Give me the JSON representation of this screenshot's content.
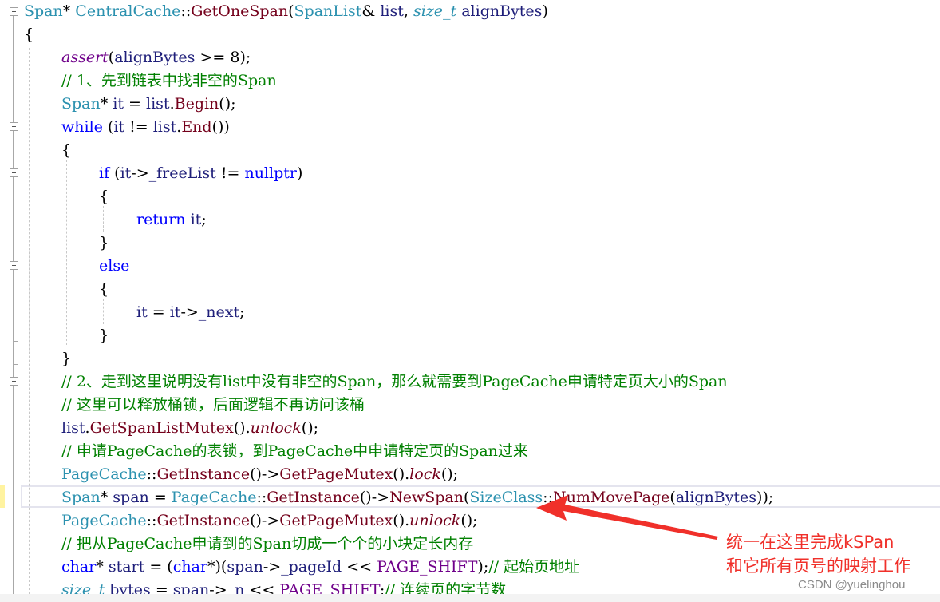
{
  "editor": {
    "colors": {
      "type": "#2b91af",
      "keyword": "#0000ff",
      "function": "#74001b",
      "macro": "#6f008a",
      "comment": "#008000",
      "identifier": "#1f1f7a",
      "annotation": "#f0302a"
    },
    "lines": [
      {
        "indent": 0,
        "tokens": [
          {
            "t": "Span",
            "c": "type"
          },
          {
            "t": "* ",
            "c": "plain"
          },
          {
            "t": "CentralCache",
            "c": "type"
          },
          {
            "t": "::",
            "c": "plain"
          },
          {
            "t": "GetOneSpan",
            "c": "function"
          },
          {
            "t": "(",
            "c": "plain"
          },
          {
            "t": "SpanList",
            "c": "type"
          },
          {
            "t": "& ",
            "c": "plain"
          },
          {
            "t": "list",
            "c": "param"
          },
          {
            "t": ", ",
            "c": "plain"
          },
          {
            "t": "size_t",
            "c": "typedef"
          },
          {
            "t": " ",
            "c": "plain"
          },
          {
            "t": "alignBytes",
            "c": "param"
          },
          {
            "t": ")",
            "c": "plain"
          }
        ]
      },
      {
        "indent": 0,
        "tokens": [
          {
            "t": "{",
            "c": "plain"
          }
        ]
      },
      {
        "indent": 1,
        "tokens": [
          {
            "t": "assert",
            "c": "macro"
          },
          {
            "t": "(",
            "c": "plain"
          },
          {
            "t": "alignBytes",
            "c": "param"
          },
          {
            "t": " >= 8);",
            "c": "plain"
          }
        ]
      },
      {
        "indent": 1,
        "tokens": [
          {
            "t": "// 1、先到链表中找非空的Span",
            "c": "comment"
          }
        ]
      },
      {
        "indent": 1,
        "tokens": [
          {
            "t": "Span",
            "c": "type"
          },
          {
            "t": "* ",
            "c": "plain"
          },
          {
            "t": "it",
            "c": "var"
          },
          {
            "t": " = ",
            "c": "plain"
          },
          {
            "t": "list",
            "c": "param"
          },
          {
            "t": ".",
            "c": "plain"
          },
          {
            "t": "Begin",
            "c": "function"
          },
          {
            "t": "();",
            "c": "plain"
          }
        ]
      },
      {
        "indent": 1,
        "tokens": [
          {
            "t": "while",
            "c": "keyword"
          },
          {
            "t": " (",
            "c": "plain"
          },
          {
            "t": "it",
            "c": "var"
          },
          {
            "t": " != ",
            "c": "plain"
          },
          {
            "t": "list",
            "c": "param"
          },
          {
            "t": ".",
            "c": "plain"
          },
          {
            "t": "End",
            "c": "function"
          },
          {
            "t": "())",
            "c": "plain"
          }
        ]
      },
      {
        "indent": 1,
        "tokens": [
          {
            "t": "{",
            "c": "plain"
          }
        ]
      },
      {
        "indent": 2,
        "tokens": [
          {
            "t": "if",
            "c": "keyword"
          },
          {
            "t": " (",
            "c": "plain"
          },
          {
            "t": "it",
            "c": "var"
          },
          {
            "t": "->",
            "c": "plain"
          },
          {
            "t": "_freeList",
            "c": "member"
          },
          {
            "t": " != ",
            "c": "plain"
          },
          {
            "t": "nullptr",
            "c": "keyword"
          },
          {
            "t": ")",
            "c": "plain"
          }
        ]
      },
      {
        "indent": 2,
        "tokens": [
          {
            "t": "{",
            "c": "plain"
          }
        ]
      },
      {
        "indent": 3,
        "tokens": [
          {
            "t": "return",
            "c": "keyword"
          },
          {
            "t": " ",
            "c": "plain"
          },
          {
            "t": "it",
            "c": "var"
          },
          {
            "t": ";",
            "c": "plain"
          }
        ]
      },
      {
        "indent": 2,
        "tokens": [
          {
            "t": "}",
            "c": "plain"
          }
        ]
      },
      {
        "indent": 2,
        "tokens": [
          {
            "t": "else",
            "c": "keyword"
          }
        ]
      },
      {
        "indent": 2,
        "tokens": [
          {
            "t": "{",
            "c": "plain"
          }
        ]
      },
      {
        "indent": 3,
        "tokens": [
          {
            "t": "it",
            "c": "var"
          },
          {
            "t": " = ",
            "c": "plain"
          },
          {
            "t": "it",
            "c": "var"
          },
          {
            "t": "->",
            "c": "plain"
          },
          {
            "t": "_next",
            "c": "member"
          },
          {
            "t": ";",
            "c": "plain"
          }
        ]
      },
      {
        "indent": 2,
        "tokens": [
          {
            "t": "}",
            "c": "plain"
          }
        ]
      },
      {
        "indent": 1,
        "tokens": [
          {
            "t": "}",
            "c": "plain"
          }
        ]
      },
      {
        "indent": 1,
        "tokens": [
          {
            "t": "// 2、走到这里说明没有list中没有非空的Span，那么就需要到PageCache申请特定页大小的Span",
            "c": "comment"
          }
        ]
      },
      {
        "indent": 1,
        "tokens": [
          {
            "t": "// 这里可以释放桶锁，后面逻辑不再访问该桶",
            "c": "comment"
          }
        ]
      },
      {
        "indent": 1,
        "tokens": [
          {
            "t": "list",
            "c": "param"
          },
          {
            "t": ".",
            "c": "plain"
          },
          {
            "t": "GetSpanListMutex",
            "c": "function"
          },
          {
            "t": "().",
            "c": "plain"
          },
          {
            "t": "unlock",
            "c": "fn-it"
          },
          {
            "t": "();",
            "c": "plain"
          }
        ]
      },
      {
        "indent": 1,
        "tokens": [
          {
            "t": "// 申请PageCache的表锁，到PageCache中申请特定页的Span过来",
            "c": "comment"
          }
        ]
      },
      {
        "indent": 1,
        "tokens": [
          {
            "t": "PageCache",
            "c": "type"
          },
          {
            "t": "::",
            "c": "plain"
          },
          {
            "t": "GetInstance",
            "c": "function"
          },
          {
            "t": "()->",
            "c": "plain"
          },
          {
            "t": "GetPageMutex",
            "c": "function"
          },
          {
            "t": "().",
            "c": "plain"
          },
          {
            "t": "lock",
            "c": "fn-it"
          },
          {
            "t": "();",
            "c": "plain"
          }
        ]
      },
      {
        "indent": 1,
        "tokens": [
          {
            "t": "Span",
            "c": "type"
          },
          {
            "t": "* ",
            "c": "plain"
          },
          {
            "t": "span",
            "c": "var"
          },
          {
            "t": " = ",
            "c": "plain"
          },
          {
            "t": "PageCache",
            "c": "type"
          },
          {
            "t": "::",
            "c": "plain"
          },
          {
            "t": "GetInstance",
            "c": "function"
          },
          {
            "t": "()->",
            "c": "plain"
          },
          {
            "t": "NewSpan",
            "c": "function"
          },
          {
            "t": "(",
            "c": "plain"
          },
          {
            "t": "SizeClass",
            "c": "type"
          },
          {
            "t": "::",
            "c": "plain"
          },
          {
            "t": "NumMovePage",
            "c": "function"
          },
          {
            "t": "(",
            "c": "plain"
          },
          {
            "t": "alignBytes",
            "c": "param"
          },
          {
            "t": "));",
            "c": "plain"
          }
        ]
      },
      {
        "indent": 1,
        "tokens": [
          {
            "t": "PageCache",
            "c": "type"
          },
          {
            "t": "::",
            "c": "plain"
          },
          {
            "t": "GetInstance",
            "c": "function"
          },
          {
            "t": "()->",
            "c": "plain"
          },
          {
            "t": "GetPageMutex",
            "c": "function"
          },
          {
            "t": "().",
            "c": "plain"
          },
          {
            "t": "unlock",
            "c": "fn-it"
          },
          {
            "t": "();",
            "c": "plain"
          }
        ]
      },
      {
        "indent": 1,
        "tokens": [
          {
            "t": "// 把从PageCache申请到的Span切成一个个的小块定长内存",
            "c": "comment"
          }
        ]
      },
      {
        "indent": 1,
        "tokens": [
          {
            "t": "char",
            "c": "keyword"
          },
          {
            "t": "* ",
            "c": "plain"
          },
          {
            "t": "start",
            "c": "var"
          },
          {
            "t": " = (",
            "c": "plain"
          },
          {
            "t": "char",
            "c": "keyword"
          },
          {
            "t": "*)(",
            "c": "plain"
          },
          {
            "t": "span",
            "c": "var"
          },
          {
            "t": "->",
            "c": "plain"
          },
          {
            "t": "_pageId",
            "c": "member"
          },
          {
            "t": " << ",
            "c": "plain"
          },
          {
            "t": "PAGE_SHIFT",
            "c": "const"
          },
          {
            "t": ");",
            "c": "plain"
          },
          {
            "t": "// 起始页地址",
            "c": "comment"
          }
        ]
      },
      {
        "indent": 1,
        "tokens": [
          {
            "t": "size_t",
            "c": "typedef"
          },
          {
            "t": " ",
            "c": "plain"
          },
          {
            "t": "bytes",
            "c": "var"
          },
          {
            "t": " = ",
            "c": "plain"
          },
          {
            "t": "span",
            "c": "var"
          },
          {
            "t": "->",
            "c": "plain"
          },
          {
            "t": "_n",
            "c": "member"
          },
          {
            "t": " << ",
            "c": "plain"
          },
          {
            "t": "PAGE_SHIFT",
            "c": "const"
          },
          {
            "t": ";",
            "c": "plain"
          },
          {
            "t": "// 连续页的字节数",
            "c": "comment"
          }
        ]
      }
    ]
  },
  "annotation": {
    "line1": "统一在这里完成kSPan",
    "line2": "和它所有页号的映射工作"
  },
  "watermark": "CSDN @yuelinghou"
}
